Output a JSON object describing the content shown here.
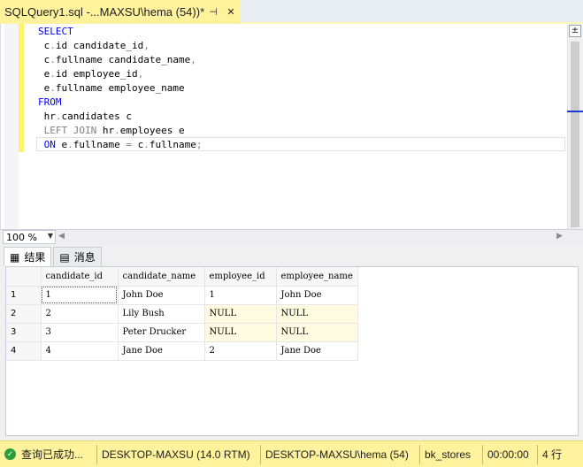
{
  "tab": {
    "title": "SQLQuery1.sql -...MAXSU\\hema (54))*",
    "pin_icon": "pin-icon",
    "close_icon": "close-icon"
  },
  "editor": {
    "lines": [
      [
        {
          "t": "SELECT",
          "c": "kw"
        }
      ],
      [
        {
          "t": " c",
          "c": ""
        },
        {
          "t": ".",
          "c": "op"
        },
        {
          "t": "id candidate_id",
          "c": ""
        },
        {
          "t": ",",
          "c": "op"
        }
      ],
      [
        {
          "t": " c",
          "c": ""
        },
        {
          "t": ".",
          "c": "op"
        },
        {
          "t": "fullname candidate_name",
          "c": ""
        },
        {
          "t": ",",
          "c": "op"
        }
      ],
      [
        {
          "t": " e",
          "c": ""
        },
        {
          "t": ".",
          "c": "op"
        },
        {
          "t": "id employee_id",
          "c": ""
        },
        {
          "t": ",",
          "c": "op"
        }
      ],
      [
        {
          "t": " e",
          "c": ""
        },
        {
          "t": ".",
          "c": "op"
        },
        {
          "t": "fullname employee_name",
          "c": ""
        }
      ],
      [
        {
          "t": "FROM",
          "c": "kw"
        }
      ],
      [
        {
          "t": " hr",
          "c": ""
        },
        {
          "t": ".",
          "c": "op"
        },
        {
          "t": "candidates c",
          "c": ""
        }
      ],
      [
        {
          "t": " ",
          "c": ""
        },
        {
          "t": "LEFT JOIN",
          "c": "op"
        },
        {
          "t": " hr",
          "c": ""
        },
        {
          "t": ".",
          "c": "op"
        },
        {
          "t": "employees e",
          "c": ""
        }
      ],
      [
        {
          "t": " ",
          "c": ""
        },
        {
          "t": "ON",
          "c": "kw"
        },
        {
          "t": " e",
          "c": ""
        },
        {
          "t": ".",
          "c": "op"
        },
        {
          "t": "fullname ",
          "c": ""
        },
        {
          "t": "=",
          "c": "op"
        },
        {
          "t": " c",
          "c": ""
        },
        {
          "t": ".",
          "c": "op"
        },
        {
          "t": "fullname",
          "c": ""
        },
        {
          "t": ";",
          "c": "op"
        }
      ]
    ]
  },
  "zoom": {
    "value": "100 %"
  },
  "results": {
    "tabs": [
      {
        "label": "结果",
        "icon": "grid-icon",
        "active": true
      },
      {
        "label": "消息",
        "icon": "messages-icon",
        "active": false
      }
    ],
    "columns": [
      "candidate_id",
      "candidate_name",
      "employee_id",
      "employee_name"
    ],
    "rows": [
      {
        "num": "1",
        "cells": [
          "1",
          "John Doe",
          "1",
          "John Doe"
        ]
      },
      {
        "num": "2",
        "cells": [
          "2",
          "Lily Bush",
          "NULL",
          "NULL"
        ]
      },
      {
        "num": "3",
        "cells": [
          "3",
          "Peter Drucker",
          "NULL",
          "NULL"
        ]
      },
      {
        "num": "4",
        "cells": [
          "4",
          "Jane Doe",
          "2",
          "Jane Doe"
        ]
      }
    ]
  },
  "status": {
    "message": "查询已成功...",
    "server": "DESKTOP-MAXSU (14.0 RTM)",
    "login": "DESKTOP-MAXSU\\hema (54)",
    "database": "bk_stores",
    "elapsed": "00:00:00",
    "rows": "4 行"
  }
}
